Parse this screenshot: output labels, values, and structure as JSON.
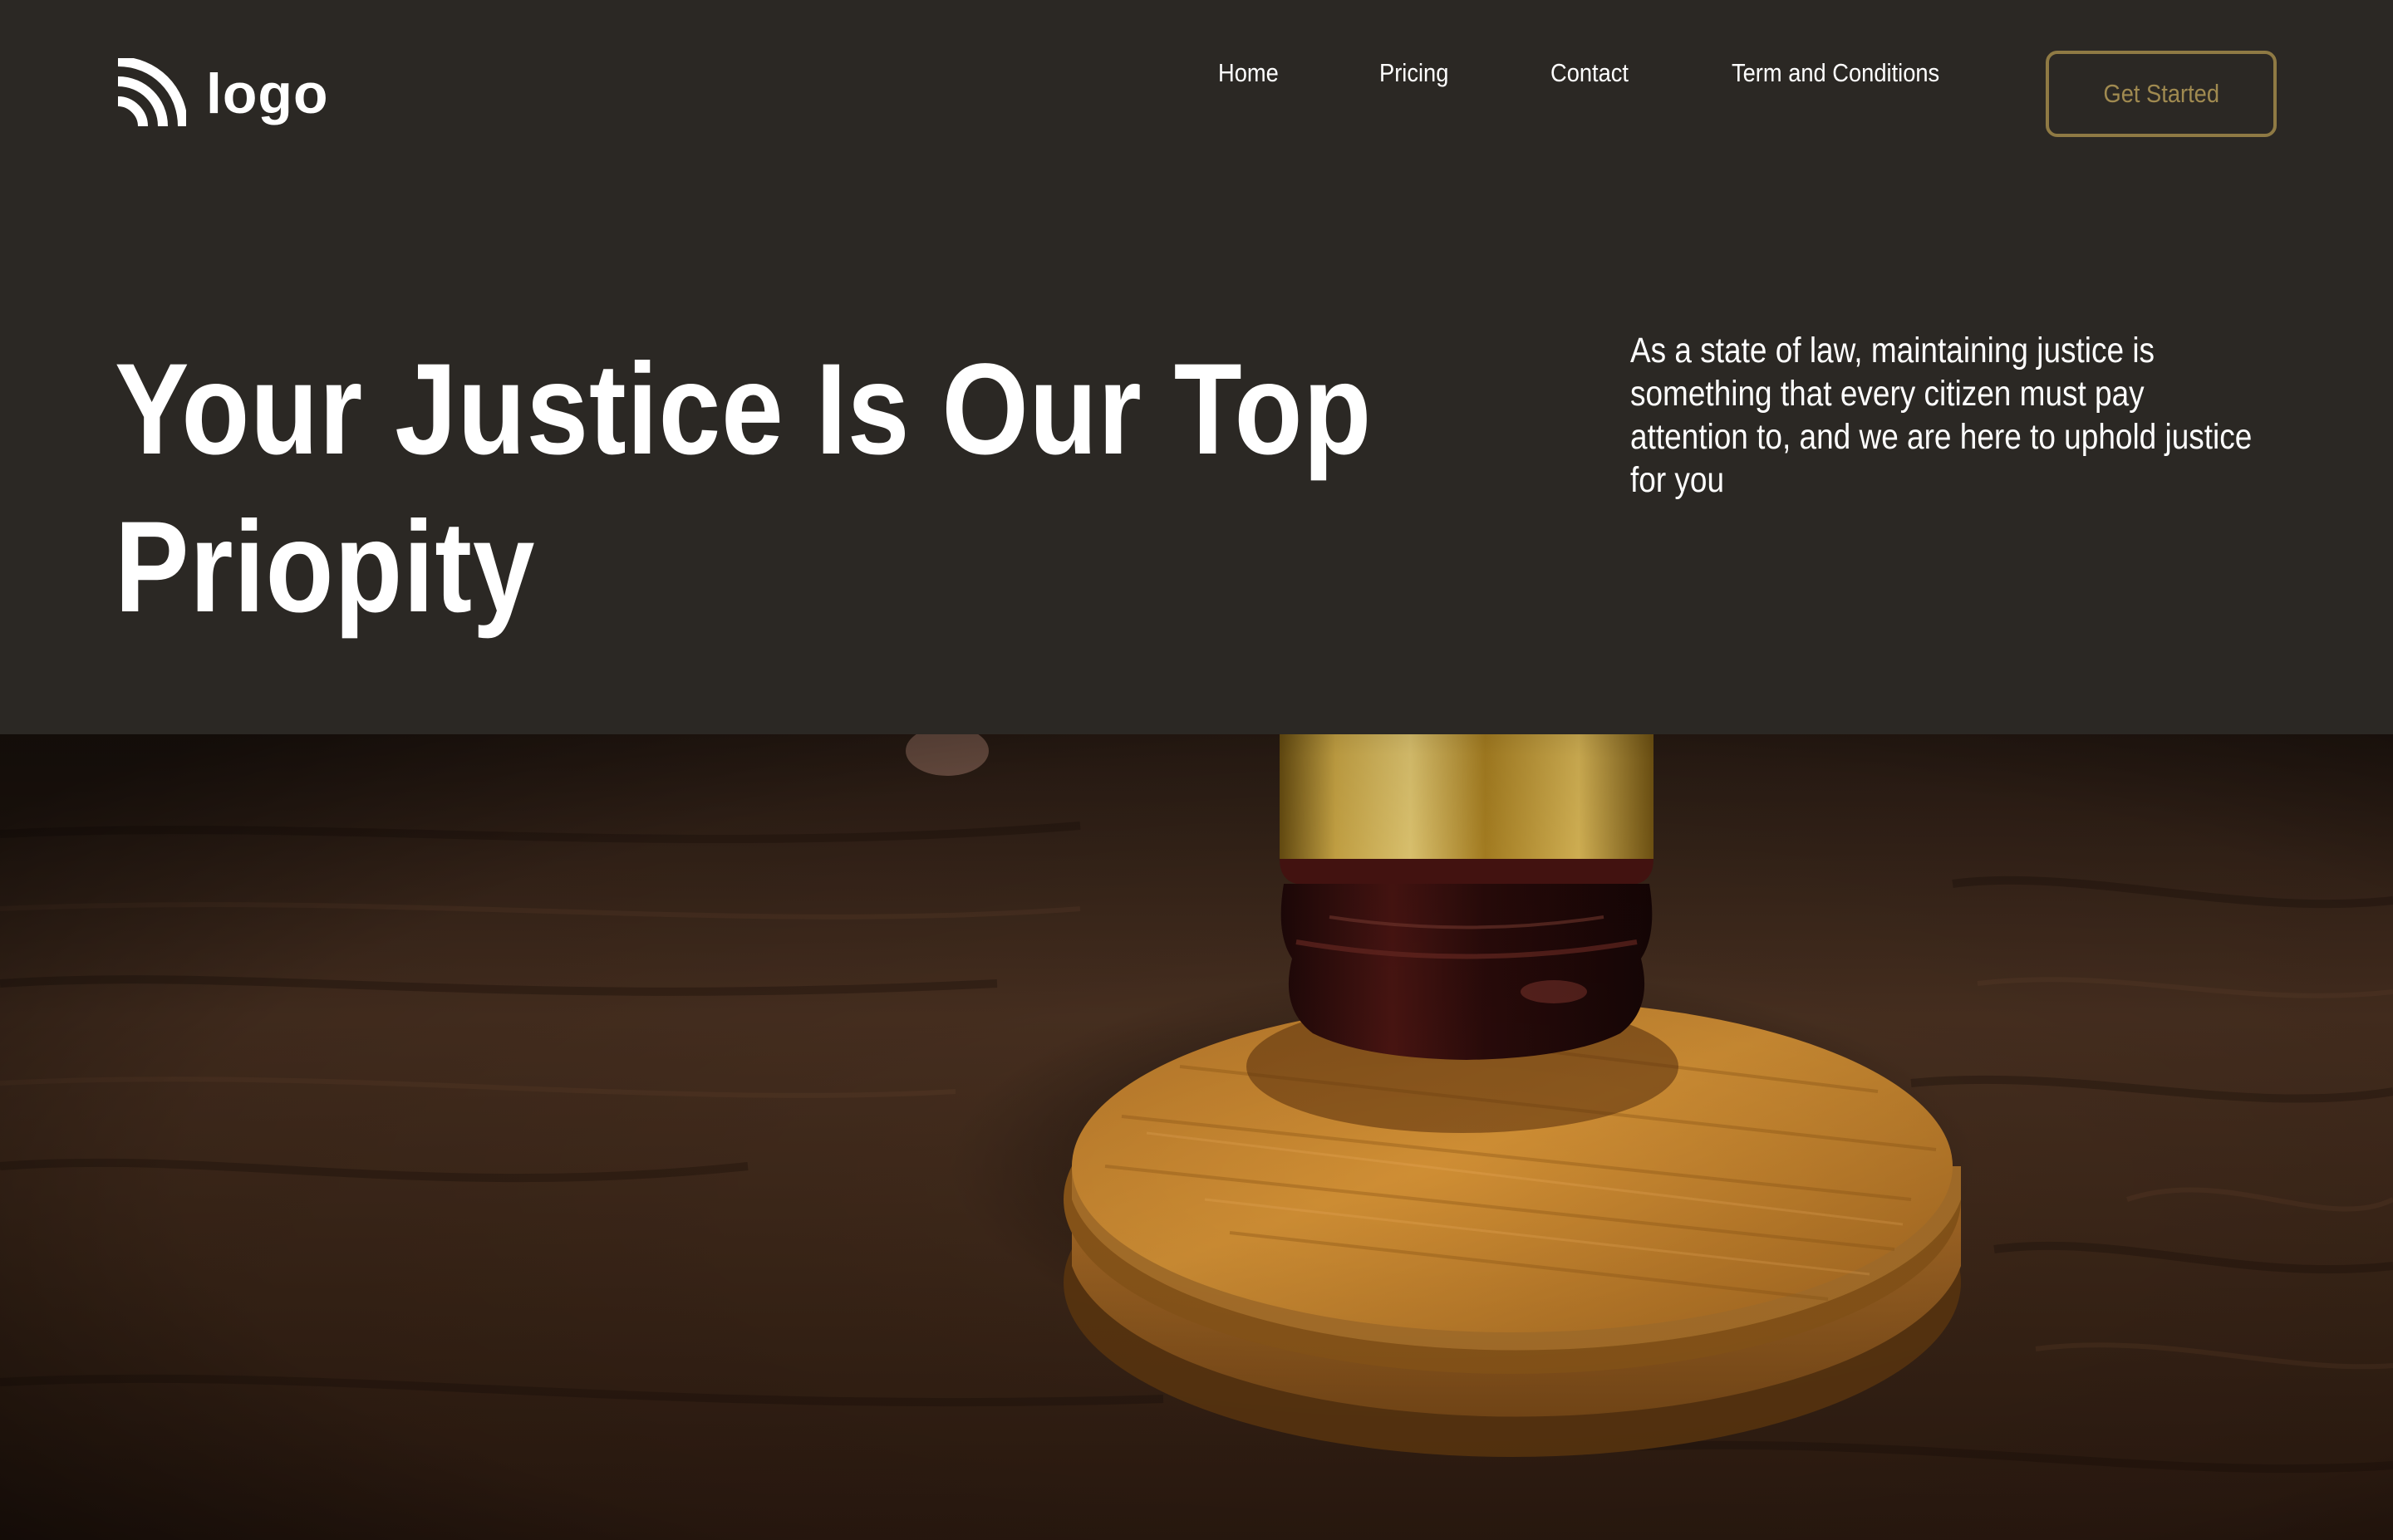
{
  "header": {
    "logo_text": "logo",
    "nav": [
      {
        "label": "Home"
      },
      {
        "label": "Pricing"
      },
      {
        "label": "Contact"
      },
      {
        "label": "Term and Conditions"
      }
    ],
    "cta_label": "Get Started"
  },
  "hero": {
    "title_lines": [
      "Your Justice Is Our Top",
      "Priopity"
    ],
    "description_lines": [
      "As a state of law, maintaining justice is",
      "something that every citizen must pay",
      "attention to, and we are here to uphold justice",
      "for you"
    ]
  },
  "image": {
    "subject": "gavel-and-sound-block-photo"
  },
  "colors": {
    "background": "#2b2824",
    "text": "#ffffff",
    "accent": "#8f7a44"
  }
}
